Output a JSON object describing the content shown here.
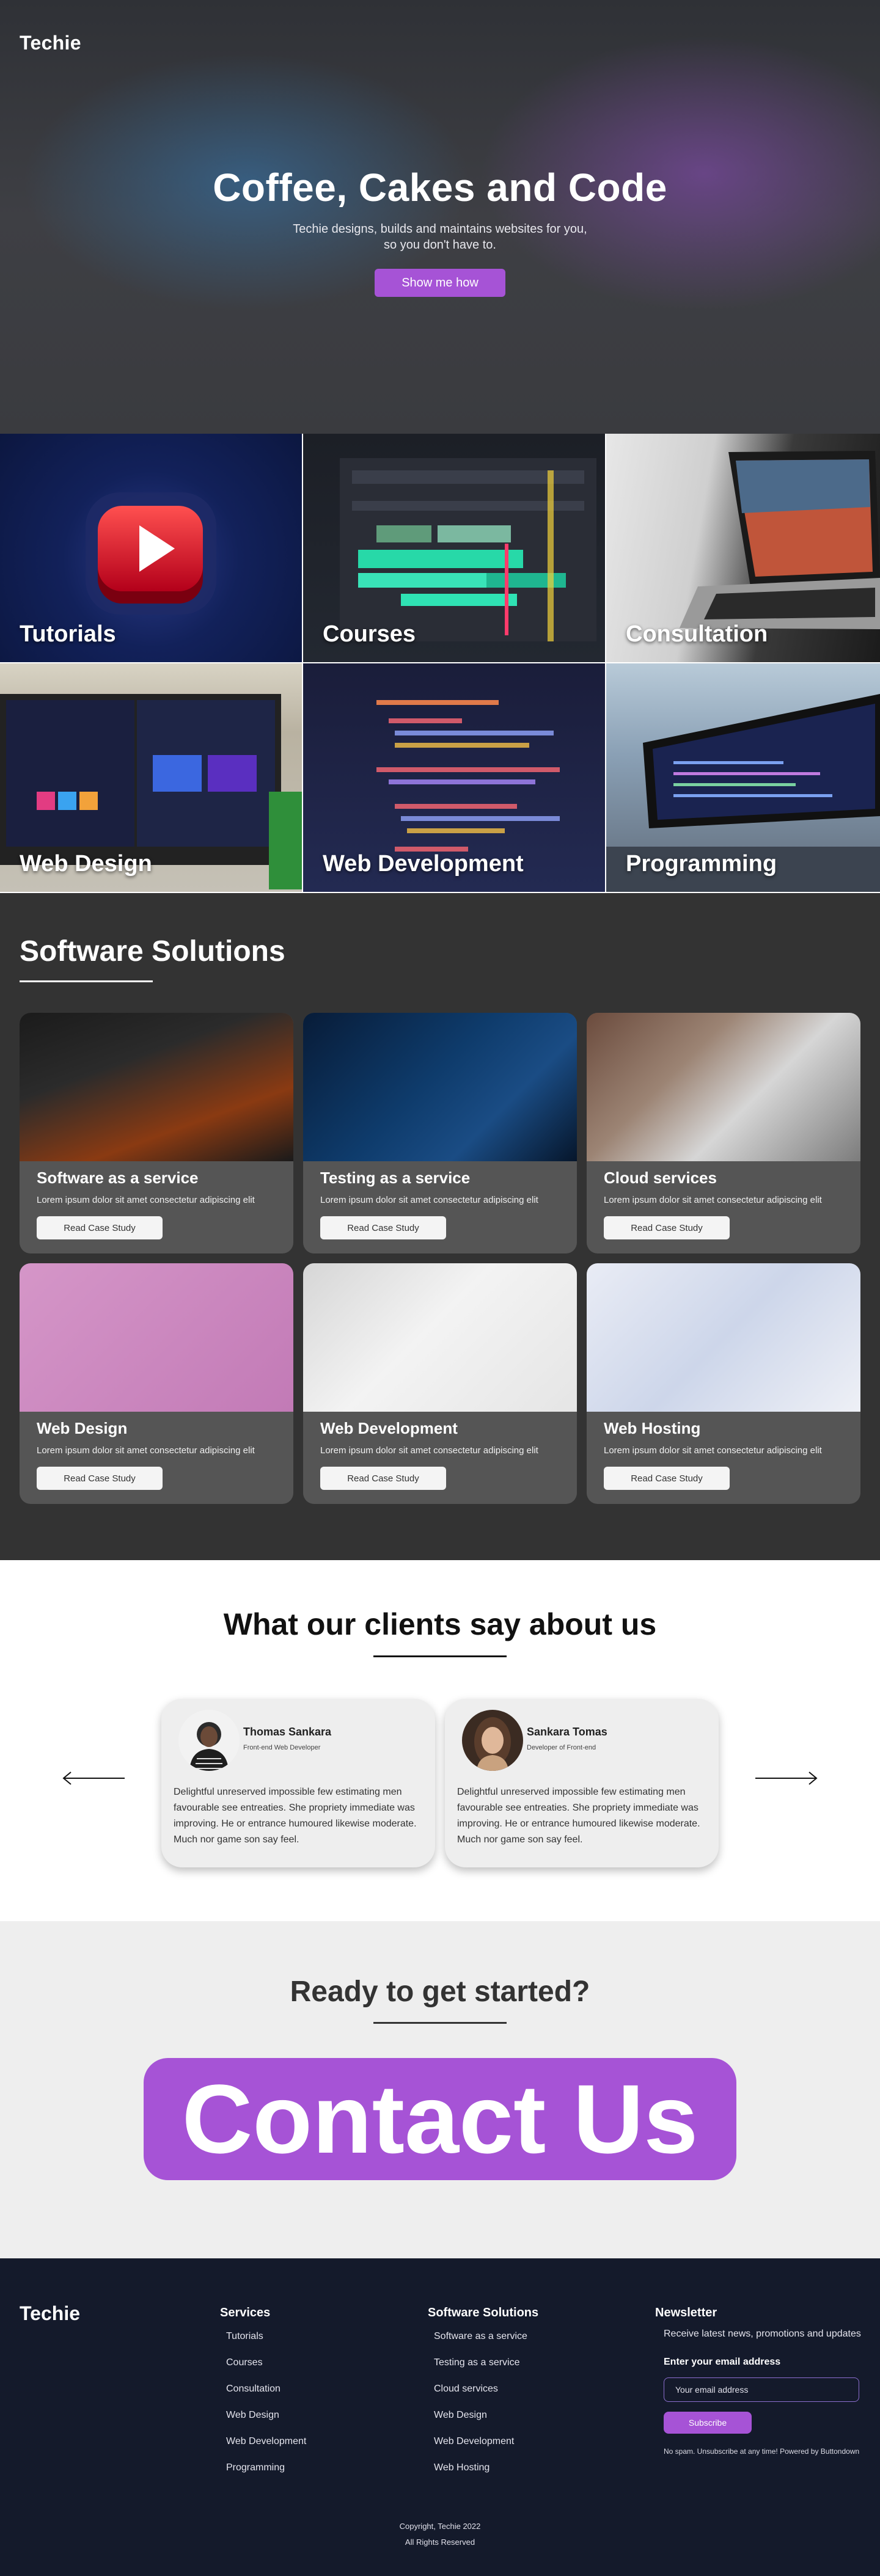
{
  "hero": {
    "logo": "Techie",
    "title": "Coffee, Cakes and Code",
    "subtitle_line1": "Techie designs, builds and maintains websites for you,",
    "subtitle_line2": "so you don't have to.",
    "button": "Show me how"
  },
  "tiles": [
    "Tutorials",
    "Courses",
    "Consultation",
    "Web Design",
    "Web Development",
    "Programming"
  ],
  "solutions": {
    "title": "Software Solutions",
    "cards": [
      {
        "title": "Software as a service",
        "text": "Lorem ipsum dolor sit amet consectetur adipiscing elit",
        "button": "Read Case Study"
      },
      {
        "title": "Testing as a service",
        "text": "Lorem ipsum dolor sit amet consectetur adipiscing elit",
        "button": "Read Case Study"
      },
      {
        "title": "Cloud services",
        "text": "Lorem ipsum dolor sit amet consectetur adipiscing elit",
        "button": "Read Case Study"
      },
      {
        "title": "Web Design",
        "text": "Lorem ipsum dolor sit amet consectetur adipiscing elit",
        "button": "Read Case Study"
      },
      {
        "title": "Web Development",
        "text": "Lorem ipsum dolor sit amet consectetur adipiscing elit",
        "button": "Read Case Study"
      },
      {
        "title": "Web Hosting",
        "text": "Lorem ipsum dolor sit amet consectetur adipiscing elit",
        "button": "Read Case Study"
      }
    ]
  },
  "testimonials": {
    "title": "What our clients say about us",
    "items": [
      {
        "name": "Thomas Sankara",
        "role": "Front-end Web Developer",
        "quote": "Delightful unreserved impossible few estimating men favourable see entreaties. She propriety immediate was improving. He or entrance humoured likewise moderate. Much nor game son say feel."
      },
      {
        "name": "Sankara Tomas",
        "role": "Developer of Front-end",
        "quote": "Delightful unreserved impossible few estimating men favourable see entreaties. She propriety immediate was improving. He or entrance humoured likewise moderate. Much nor game son say feel."
      }
    ]
  },
  "cta": {
    "title": "Ready to get started?",
    "button": "Contact Us"
  },
  "footer": {
    "logo": "Techie",
    "services_title": "Services",
    "services": [
      "Tutorials",
      "Courses",
      "Consultation",
      "Web Design",
      "Web Development",
      "Programming"
    ],
    "solutions_title": "Software Solutions",
    "solutions": [
      "Software as a service",
      "Testing as a service",
      "Cloud services",
      "Web Design",
      "Web Development",
      "Web Hosting"
    ],
    "newsletter_title": "Newsletter",
    "newsletter_text": "Receive latest news, promotions and updates",
    "email_label": "Enter your email address",
    "email_placeholder": "Your email address",
    "subscribe": "Subscribe",
    "note": "No spam. Unsubscribe at any time! Powered by Buttondown",
    "copyright": "Copyright, Techie 2022",
    "rights": "All Rights Reserved"
  },
  "colors": {
    "accent": "#a653d6",
    "dark_section": "#333333",
    "card": "#555555",
    "footer": "#141a2b"
  }
}
